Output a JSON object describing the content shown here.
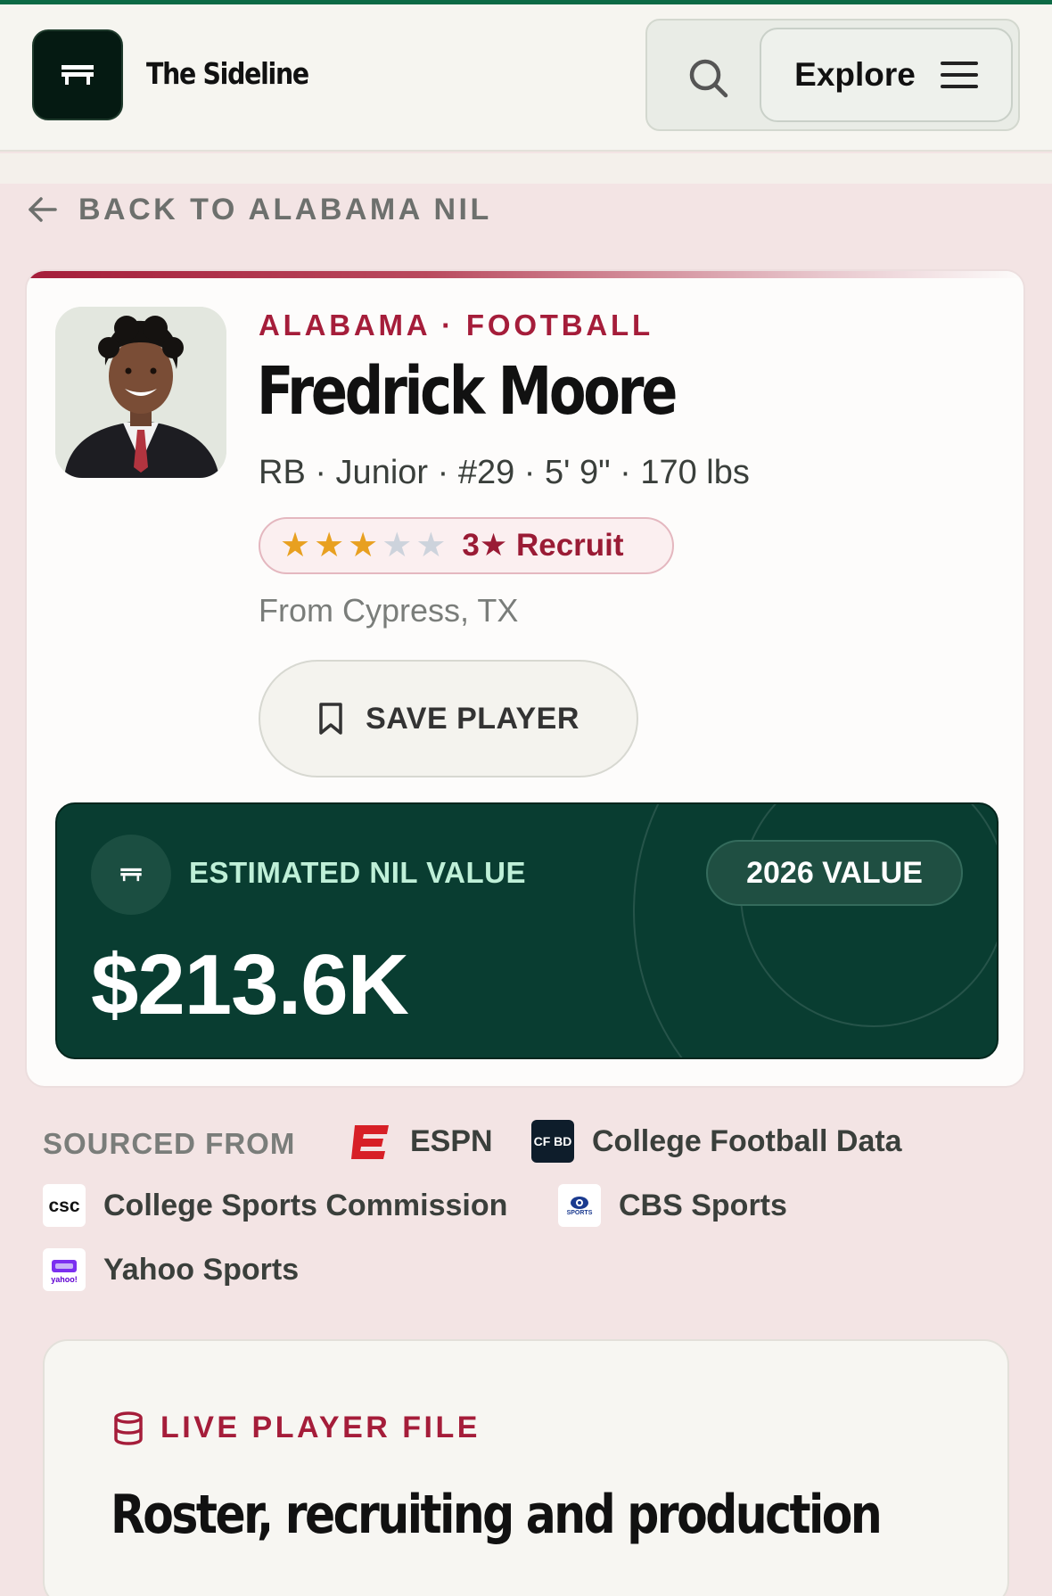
{
  "header": {
    "brand": "The Sideline",
    "explore_label": "Explore"
  },
  "back_link": "BACK TO ALABAMA NIL",
  "player": {
    "school_line": "ALABAMA · FOOTBALL",
    "name": "Fredrick Moore",
    "bio": "RB · Junior · #29 · 5' 9\" · 170 lbs",
    "rating": 3,
    "rating_max": 5,
    "recruit_label": "3★ Recruit",
    "hometown": "From Cypress, TX",
    "save_label": "SAVE PLAYER"
  },
  "nil": {
    "label": "ESTIMATED NIL VALUE",
    "year_badge": "2026 VALUE",
    "amount": "$213.6K"
  },
  "sources": {
    "label": "SOURCED FROM",
    "items": [
      {
        "name": "ESPN",
        "logo_text": ""
      },
      {
        "name": "College Football Data",
        "logo_text": "CF BD"
      },
      {
        "name": "College Sports Commission",
        "logo_text": "csc"
      },
      {
        "name": "CBS Sports",
        "logo_text": "SPORTS"
      },
      {
        "name": "Yahoo Sports",
        "logo_text": "yahoo!"
      }
    ]
  },
  "file_section": {
    "kicker": "LIVE PLAYER FILE",
    "title": "Roster, recruiting and production"
  },
  "colors": {
    "accent": "#a51d3a",
    "brand_green": "#0c6a45",
    "nil_bg": "#093d31",
    "star": "#e8a020"
  }
}
